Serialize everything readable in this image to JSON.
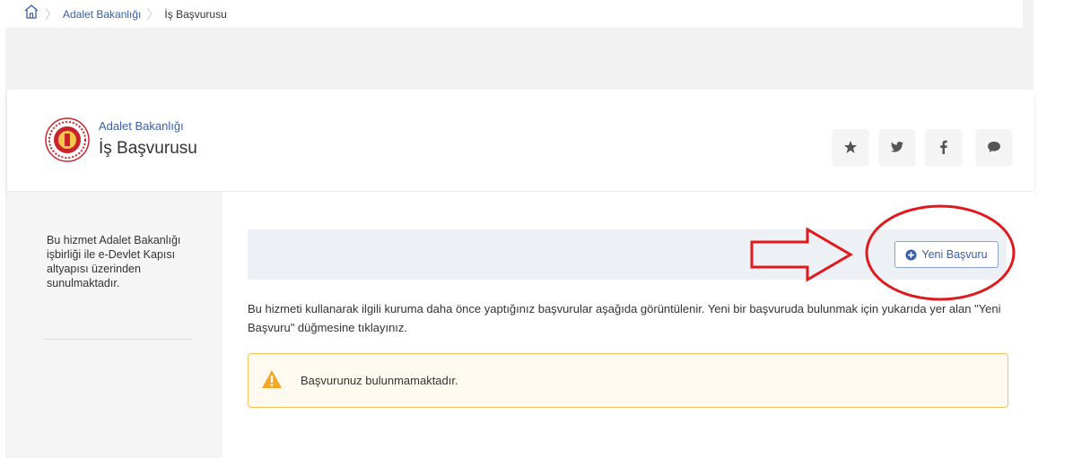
{
  "breadcrumb": {
    "items": [
      "Adalet Bakanlığı",
      "İş Başvurusu"
    ]
  },
  "header": {
    "institution": "Adalet Bakanlığı",
    "service": "İş Başvurusu"
  },
  "social": {
    "icons": [
      "star-icon",
      "twitter-icon",
      "facebook-icon",
      "comment-icon"
    ]
  },
  "sidebar": {
    "info": "Bu hizmet Adalet Bakanlığı işbirliği ile e-Devlet Kapısı altyapısı üzerinden sunulmaktadır."
  },
  "main": {
    "new_button": "Yeni Başvuru",
    "description": "Bu hizmeti kullanarak ilgili kuruma daha önce yaptığınız başvurular aşağıda görüntülenir. Yeni bir başvuruda bulunmak için yukarıda yer alan \"Yeni Başvuru\" düğmesine tıklayınız.",
    "warning": "Başvurunuz bulunmamaktadır."
  },
  "colors": {
    "link": "#3a5fa6",
    "annotation": "#e0191d",
    "warning_border": "#f4c05a",
    "warning_icon": "#f5a623"
  }
}
